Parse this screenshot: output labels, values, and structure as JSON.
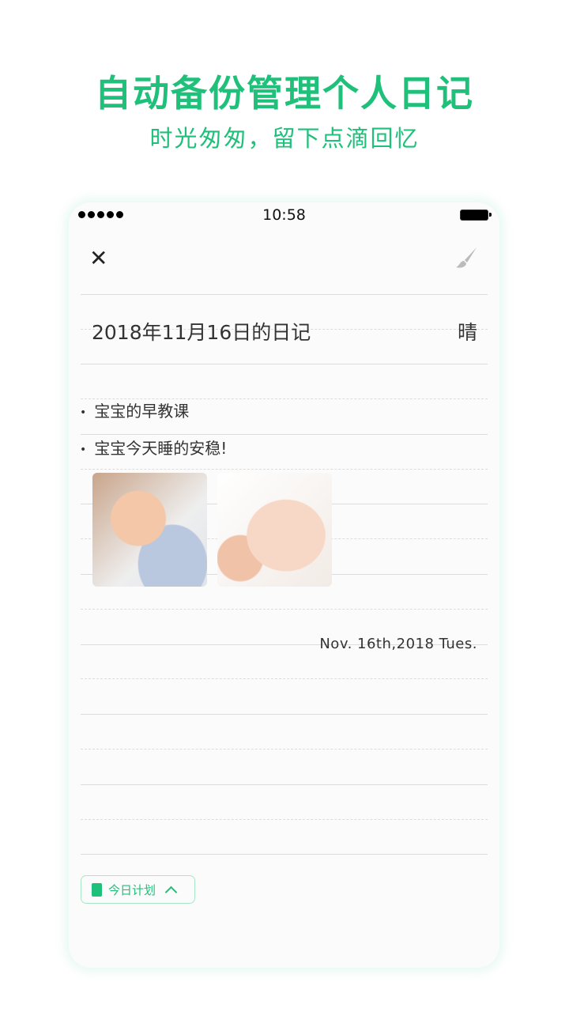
{
  "promo": {
    "headline": "自动备份管理个人日记",
    "subtitle": "时光匆匆，留下点滴回忆"
  },
  "status": {
    "time": "10:58"
  },
  "diary": {
    "title": "2018年11月16日的日记",
    "weather": "晴",
    "items": [
      {
        "bullet": "•",
        "text": "宝宝的早教课"
      },
      {
        "bullet": "•",
        "text": "宝宝今天睡的安稳!"
      }
    ],
    "date_en": "Nov. 16th,2018  Tues."
  },
  "plan_button": {
    "label": "今日计划"
  },
  "colors": {
    "accent": "#1fc07a"
  }
}
